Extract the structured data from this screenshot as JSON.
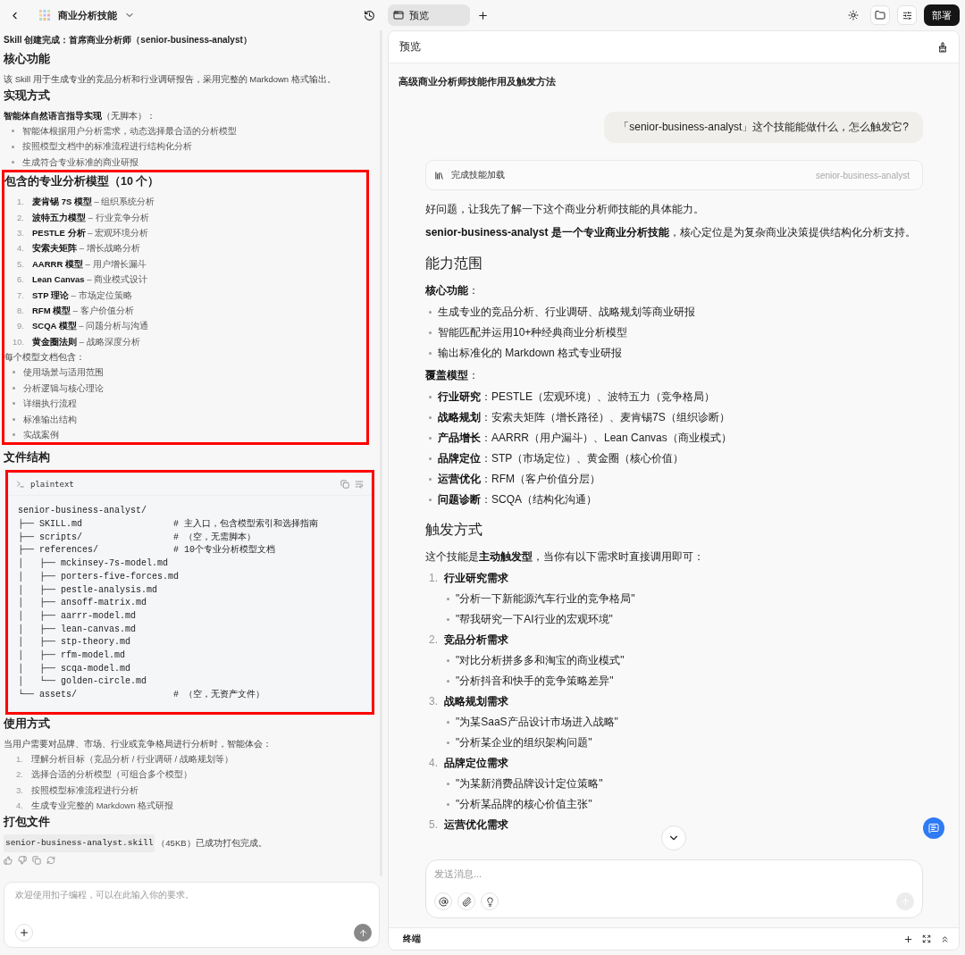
{
  "left": {
    "header": {
      "title": "商业分析技能"
    },
    "blocks": [
      {
        "kind": "title",
        "text": "Skill 创建完成：首席商业分析师（senior-business-analyst）"
      },
      {
        "kind": "heading",
        "text": "核心功能"
      },
      {
        "kind": "paragraph",
        "text": "该 Skill 用于生成专业的竞品分析和行业调研报告，采用完整的 Markdown 格式输出。"
      },
      {
        "kind": "heading",
        "text": "实现方式"
      },
      {
        "kind": "paragraph",
        "text": "**智能体自然语言指导实现**（无脚本）："
      },
      {
        "kind": "bullets",
        "items": [
          "智能体根据用户分析需求，动态选择最合适的分析模型",
          "按照模型文档中的标准流程进行结构化分析",
          "生成符合专业标准的商业研报"
        ]
      },
      {
        "kind": "group",
        "highlighted": true,
        "blocks": [
          {
            "kind": "heading",
            "text": "包含的专业分析模型（10 个）"
          },
          {
            "kind": "numbered",
            "items": [
              {
                "number": "1.",
                "text": "**麦肯锡 7S 模型** – 组织系统分析"
              },
              {
                "number": "2.",
                "text": "**波特五力模型** – 行业竞争分析"
              },
              {
                "number": "3.",
                "text": "**PESTLE 分析** – 宏观环境分析"
              },
              {
                "number": "4.",
                "text": "**安索夫矩阵** – 增长战略分析"
              },
              {
                "number": "5.",
                "text": "**AARRR 模型** – 用户增长漏斗"
              },
              {
                "number": "6.",
                "text": "**Lean Canvas** – 商业模式设计"
              },
              {
                "number": "7.",
                "text": "**STP 理论** – 市场定位策略"
              },
              {
                "number": "8.",
                "text": "**RFM 模型** – 客户价值分析"
              },
              {
                "number": "9.",
                "text": "**SCQA 模型** – 问题分析与沟通"
              },
              {
                "number": "10.",
                "text": "**黄金圈法则** – 战略深度分析"
              }
            ]
          },
          {
            "kind": "paragraph",
            "text": "每个模型文档包含："
          },
          {
            "kind": "bullets",
            "items": [
              "使用场景与适用范围",
              "分析逻辑与核心理论",
              "详细执行流程",
              "标准输出结构",
              "实战案例"
            ]
          }
        ]
      },
      {
        "kind": "heading",
        "text": "文件结构"
      },
      {
        "kind": "code",
        "highlighted": true,
        "language": "plaintext",
        "lines": [
          "senior-business-analyst/",
          "├── SKILL.md                 # 主入口，包含模型索引和选择指南",
          "├── scripts/                 # （空，无需脚本）",
          "├── references/              # 10个专业分析模型文档",
          "│   ├── mckinsey-7s-model.md",
          "│   ├── porters-five-forces.md",
          "│   ├── pestle-analysis.md",
          "│   ├── ansoff-matrix.md",
          "│   ├── aarrr-model.md",
          "│   ├── lean-canvas.md",
          "│   ├── stp-theory.md",
          "│   ├── rfm-model.md",
          "│   ├── scqa-model.md",
          "│   └── golden-circle.md",
          "└── assets/                  # （空，无资产文件）"
        ]
      },
      {
        "kind": "heading",
        "text": "使用方式"
      },
      {
        "kind": "paragraph",
        "text": "当用户需要对品牌、市场、行业或竞争格局进行分析时，智能体会："
      },
      {
        "kind": "numbered",
        "items": [
          {
            "number": "1.",
            "text": "理解分析目标（竞品分析 / 行业调研 / 战略规划等）"
          },
          {
            "number": "2.",
            "text": "选择合适的分析模型（可组合多个模型）"
          },
          {
            "number": "3.",
            "text": "按照模型标准流程进行分析"
          },
          {
            "number": "4.",
            "text": "生成专业完整的 Markdown 格式研报"
          }
        ]
      },
      {
        "kind": "heading",
        "text": "打包文件"
      },
      {
        "kind": "package",
        "file": "senior-business-analyst.skill",
        "text": "（45KB）已成功打包完成。"
      }
    ],
    "composer": {
      "placeholder": "欢迎使用扣子编程，可以在此输入你的要求。"
    }
  },
  "right": {
    "tabs": [
      {
        "label": "预览",
        "selected": true
      }
    ],
    "deploy_button": "部署",
    "panel_title": "预览",
    "conversation_title": "高级商业分析师技能作用及触发方法",
    "user_message": "「senior-business-analyst」这个技能能做什么，怎么触发它?",
    "tool_card": {
      "label": "完成技能加载",
      "skill": "senior-business-analyst"
    },
    "blocks": [
      {
        "kind": "paragraph",
        "text": "好问题，让我先了解一下这个商业分析师技能的具体能力。"
      },
      {
        "kind": "paragraph",
        "text": "**senior-business-analyst 是一个专业商业分析技能**，核心定位是为复杂商业决策提供结构化分析支持。"
      },
      {
        "kind": "heading",
        "text": "能力范围"
      },
      {
        "kind": "paragraph",
        "text": "**核心功能**："
      },
      {
        "kind": "bullets",
        "items": [
          "生成专业的竞品分析、行业调研、战略规划等商业研报",
          "智能匹配并运用10+种经典商业分析模型",
          "输出标准化的 Markdown 格式专业研报"
        ]
      },
      {
        "kind": "paragraph",
        "text": "**覆盖模型**："
      },
      {
        "kind": "bullets",
        "items": [
          "**行业研究**：PESTLE（宏观环境）、波特五力（竞争格局）",
          "**战略规划**：安索夫矩阵（增长路径）、麦肯锡7S（组织诊断）",
          "**产品增长**：AARRR（用户漏斗）、Lean Canvas（商业模式）",
          "**品牌定位**：STP（市场定位）、黄金圈（核心价值）",
          "**运营优化**：RFM（客户价值分层）",
          "**问题诊断**：SCQA（结构化沟通）"
        ]
      },
      {
        "kind": "heading",
        "text": "触发方式"
      },
      {
        "kind": "paragraph",
        "text": "这个技能是**主动触发型**，当你有以下需求时直接调用即可："
      },
      {
        "kind": "numbered",
        "items": [
          {
            "number": "1.",
            "text": "行业研究需求",
            "children": [
              "\"分析一下新能源汽车行业的竞争格局\"",
              "\"帮我研究一下AI行业的宏观环境\""
            ]
          },
          {
            "number": "2.",
            "text": "竞品分析需求",
            "children": [
              "\"对比分析拼多多和淘宝的商业模式\"",
              "\"分析抖音和快手的竞争策略差异\""
            ]
          },
          {
            "number": "3.",
            "text": "战略规划需求",
            "children": [
              "\"为某SaaS产品设计市场进入战略\"",
              "\"分析某企业的组织架构问题\""
            ]
          },
          {
            "number": "4.",
            "text": "品牌定位需求",
            "children": [
              "\"为某新消费品牌设计定位策略\"",
              "\"分析某品牌的核心价值主张\""
            ]
          },
          {
            "number": "5.",
            "text": "运营优化需求"
          }
        ]
      }
    ],
    "composer": {
      "placeholder": "发送消息..."
    },
    "terminal": {
      "title": "终端"
    }
  }
}
